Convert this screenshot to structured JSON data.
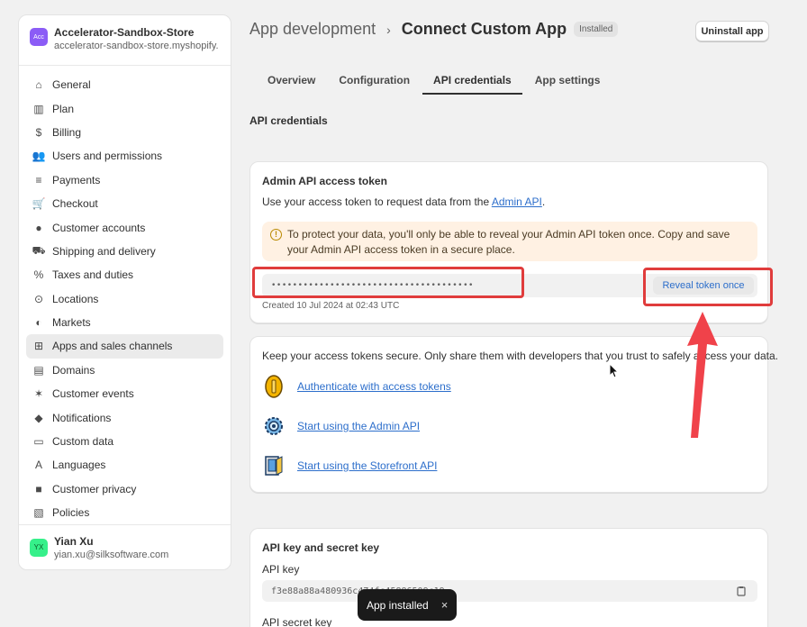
{
  "store": {
    "avatar_text": "Acc",
    "name": "Accelerator-Sandbox-Store",
    "domain": "accelerator-sandbox-store.myshopify.com"
  },
  "nav": [
    {
      "label": "General",
      "icon": "store-icon"
    },
    {
      "label": "Plan",
      "icon": "plan-icon"
    },
    {
      "label": "Billing",
      "icon": "billing-icon"
    },
    {
      "label": "Users and permissions",
      "icon": "users-icon"
    },
    {
      "label": "Payments",
      "icon": "payments-icon"
    },
    {
      "label": "Checkout",
      "icon": "cart-icon"
    },
    {
      "label": "Customer accounts",
      "icon": "person-icon"
    },
    {
      "label": "Shipping and delivery",
      "icon": "truck-icon"
    },
    {
      "label": "Taxes and duties",
      "icon": "tax-icon"
    },
    {
      "label": "Locations",
      "icon": "location-icon"
    },
    {
      "label": "Markets",
      "icon": "globe-icon"
    },
    {
      "label": "Apps and sales channels",
      "icon": "apps-icon",
      "active": true
    },
    {
      "label": "Domains",
      "icon": "domains-icon"
    },
    {
      "label": "Customer events",
      "icon": "events-icon"
    },
    {
      "label": "Notifications",
      "icon": "bell-icon"
    },
    {
      "label": "Custom data",
      "icon": "data-icon"
    },
    {
      "label": "Languages",
      "icon": "language-icon"
    },
    {
      "label": "Customer privacy",
      "icon": "lock-icon"
    },
    {
      "label": "Policies",
      "icon": "policy-icon"
    }
  ],
  "user": {
    "initials": "YX",
    "name": "Yian Xu",
    "email": "yian.xu@silksoftware.com"
  },
  "header": {
    "breadcrumb": "App development",
    "separator": "›",
    "title": "Connect Custom App",
    "badge": "Installed",
    "uninstall_label": "Uninstall app"
  },
  "tabs": [
    {
      "label": "Overview"
    },
    {
      "label": "Configuration"
    },
    {
      "label": "API credentials",
      "active": true
    },
    {
      "label": "App settings"
    }
  ],
  "section_title": "API credentials",
  "admin_token": {
    "heading": "Admin API access token",
    "desc_prefix": "Use your access token to request data from the ",
    "desc_link": "Admin API",
    "desc_suffix": ".",
    "warning_icon": "!",
    "warning": "To protect your data, you'll only be able to reveal your Admin API token once. Copy and save your Admin API access token in a secure place.",
    "masked_token": "••••••••••••••••••••••••••••••••••••••",
    "reveal_label": "Reveal token once",
    "created": "Created 10 Jul 2024 at 02:43 UTC"
  },
  "security": {
    "text": "Keep your access tokens secure. Only share them with developers that you trust to safely access your data.",
    "links": [
      {
        "label": "Authenticate with access tokens",
        "icon": "coin-icon"
      },
      {
        "label": "Start using the Admin API",
        "icon": "gear-icon"
      },
      {
        "label": "Start using the Storefront API",
        "icon": "storefront-icon"
      }
    ]
  },
  "api_keys": {
    "heading": "API key and secret key",
    "api_key_label": "API key",
    "api_key_value": "f3e88a88a480936c474fc45886509c19",
    "secret_label": "API secret key"
  },
  "toast": {
    "text": "App installed",
    "close": "×"
  },
  "colors": {
    "accent": "#2c6ecb",
    "highlight": "#e03c3c",
    "warning_bg": "#fff1e3"
  }
}
